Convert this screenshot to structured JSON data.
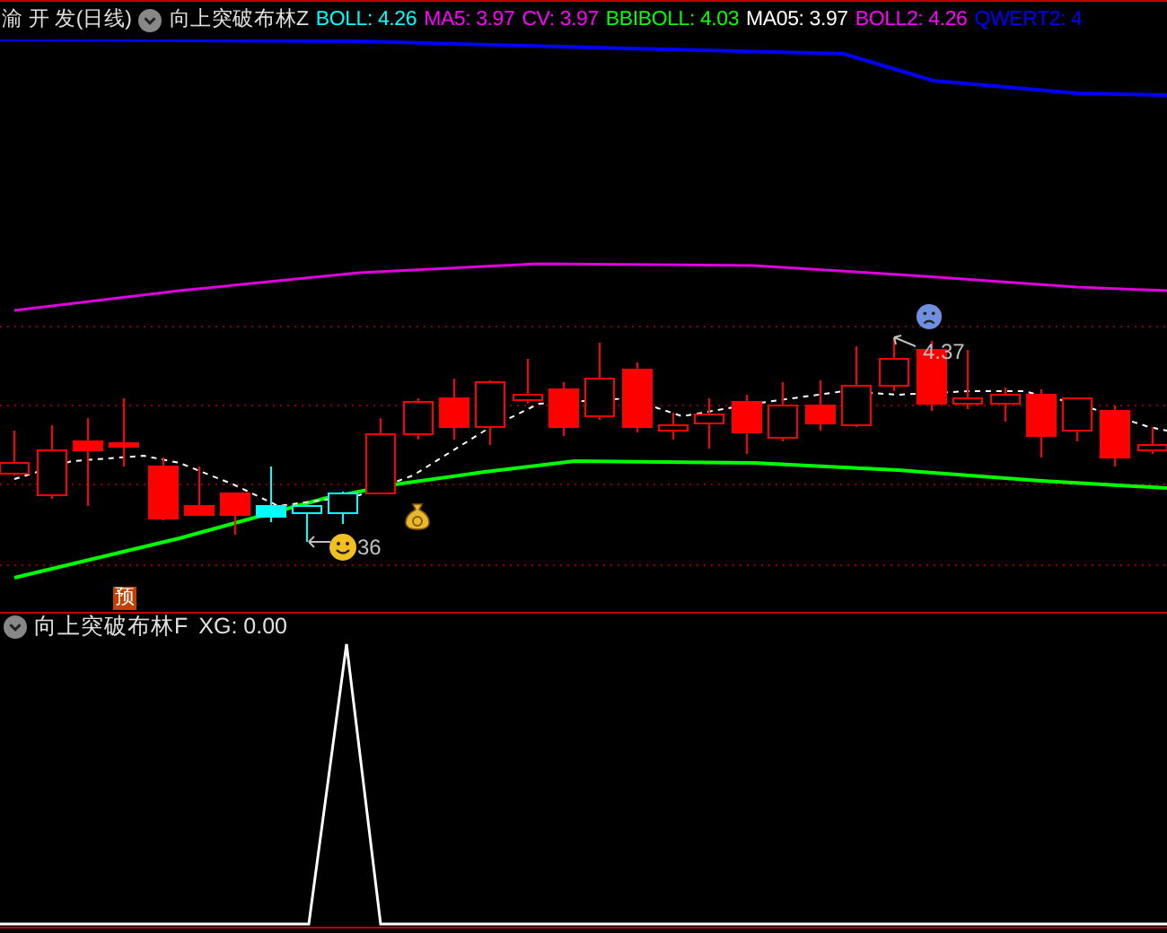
{
  "main_panel": {
    "stock": "渝 开 发(日线)",
    "indicator_name": "向上突破布林Z",
    "readings": [
      {
        "text": "BOLL: 4.26",
        "color": "#00ffff"
      },
      {
        "text": "MA5: 3.97",
        "color": "#ff00ff"
      },
      {
        "text": "CV: 3.97",
        "color": "#ff00ff"
      },
      {
        "text": "BBIBOLL: 4.03",
        "color": "#00ff00"
      },
      {
        "text": "MA05: 3.97",
        "color": "#ffffff"
      },
      {
        "text": "BOLL2: 4.26",
        "color": "#ff00ff"
      },
      {
        "text": "QWERT2: 4",
        "color": "#0000ff"
      }
    ]
  },
  "annotations": {
    "high_label": "4.37",
    "low_label": "36",
    "forecast_badge": "预"
  },
  "sub_panel": {
    "indicator_name": "向上突破布林F",
    "reading": "XG: 0.00"
  }
}
